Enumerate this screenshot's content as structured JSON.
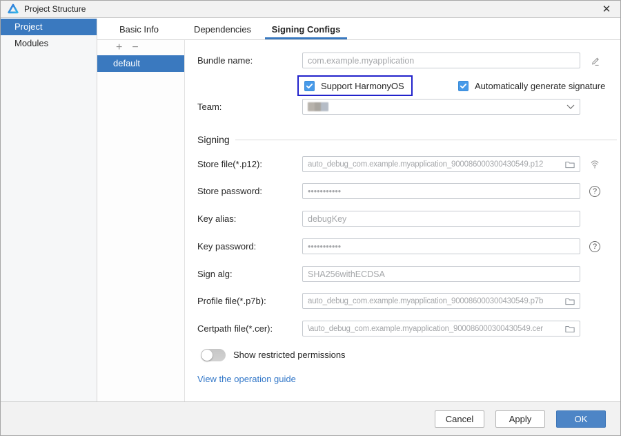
{
  "window": {
    "title": "Project Structure",
    "close_glyph": "✕"
  },
  "sidebar": {
    "items": [
      {
        "label": "Project",
        "selected": true
      },
      {
        "label": "Modules",
        "selected": false
      }
    ]
  },
  "tabs": [
    {
      "label": "Basic Info",
      "active": false
    },
    {
      "label": "Dependencies",
      "active": false
    },
    {
      "label": "Signing Configs",
      "active": true
    }
  ],
  "config_list": {
    "add_label": "+",
    "remove_label": "−",
    "items": [
      {
        "label": "default",
        "selected": true
      }
    ]
  },
  "form": {
    "bundle_name": {
      "label": "Bundle name:",
      "value": "com.example.myapplication"
    },
    "support_harmonyos": {
      "label": "Support HarmonyOS",
      "checked": true,
      "highlighted": true
    },
    "auto_signature": {
      "label": "Automatically generate signature",
      "checked": true
    },
    "team": {
      "label": "Team:",
      "value": ""
    },
    "signing_section_title": "Signing",
    "store_file": {
      "label": "Store file(*.p12):",
      "value": "auto_debug_com.example.myapplication_900086000300430549.p12"
    },
    "store_password": {
      "label": "Store password:",
      "value": "•••••••••••"
    },
    "key_alias": {
      "label": "Key alias:",
      "value": "debugKey"
    },
    "key_password": {
      "label": "Key password:",
      "value": "•••••••••••"
    },
    "sign_alg": {
      "label": "Sign alg:",
      "value": "SHA256withECDSA"
    },
    "profile_file": {
      "label": "Profile file(*.p7b):",
      "value": "auto_debug_com.example.myapplication_900086000300430549.p7b"
    },
    "certpath_file": {
      "label": "Certpath file(*.cer):",
      "value": "\\auto_debug_com.example.myapplication_900086000300430549.cer"
    },
    "show_restricted": {
      "label": "Show restricted permissions",
      "on": false
    },
    "guide_link": "View the operation guide"
  },
  "footer": {
    "cancel": "Cancel",
    "apply": "Apply",
    "ok": "OK"
  },
  "colors": {
    "selection_blue": "#3a79bf",
    "checkbox_blue": "#479ae9",
    "highlight_border": "#2122cb",
    "ok_button": "#4d85c6",
    "link": "#3277c8"
  }
}
